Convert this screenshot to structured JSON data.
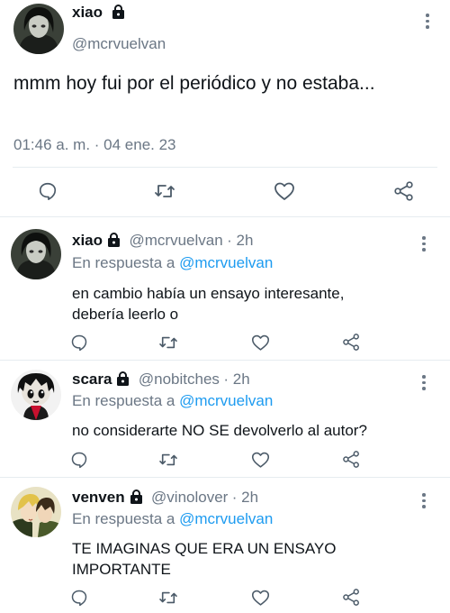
{
  "main_tweet": {
    "name": "xiao",
    "handle": "@mcrvuelvan",
    "text": "mmm hoy fui por el periódico y no estaba...",
    "timestamp": "01:46 a. m. · 04 ene. 23"
  },
  "replies": [
    {
      "name": "xiao",
      "handle": "@mcrvuelvan",
      "time": "· 2h",
      "reply_prefix": "En respuesta a",
      "reply_to": "@mcrvuelvan",
      "text": "en cambio había un ensayo interesante, debería leerlo o"
    },
    {
      "name": "scara",
      "handle": "@nobitches",
      "time": "· 2h",
      "reply_prefix": "En respuesta a",
      "reply_to": "@mcrvuelvan",
      "text": "no considerarte NO SE devolverlo al autor?"
    },
    {
      "name": "venven",
      "handle": "@vinolover",
      "time": "· 2h",
      "reply_prefix": "En respuesta a",
      "reply_to": "@mcrvuelvan",
      "text": "TE IMAGINAS QUE ERA UN ENSAYO IMPORTANTE"
    }
  ],
  "colors": {
    "text": "#0f1419",
    "secondary": "#6b7785",
    "link": "#1d9bf0",
    "divider": "#e6ecf0"
  },
  "icons": [
    "lock-icon",
    "more-icon",
    "reply-icon",
    "retweet-icon",
    "like-icon",
    "share-icon"
  ]
}
